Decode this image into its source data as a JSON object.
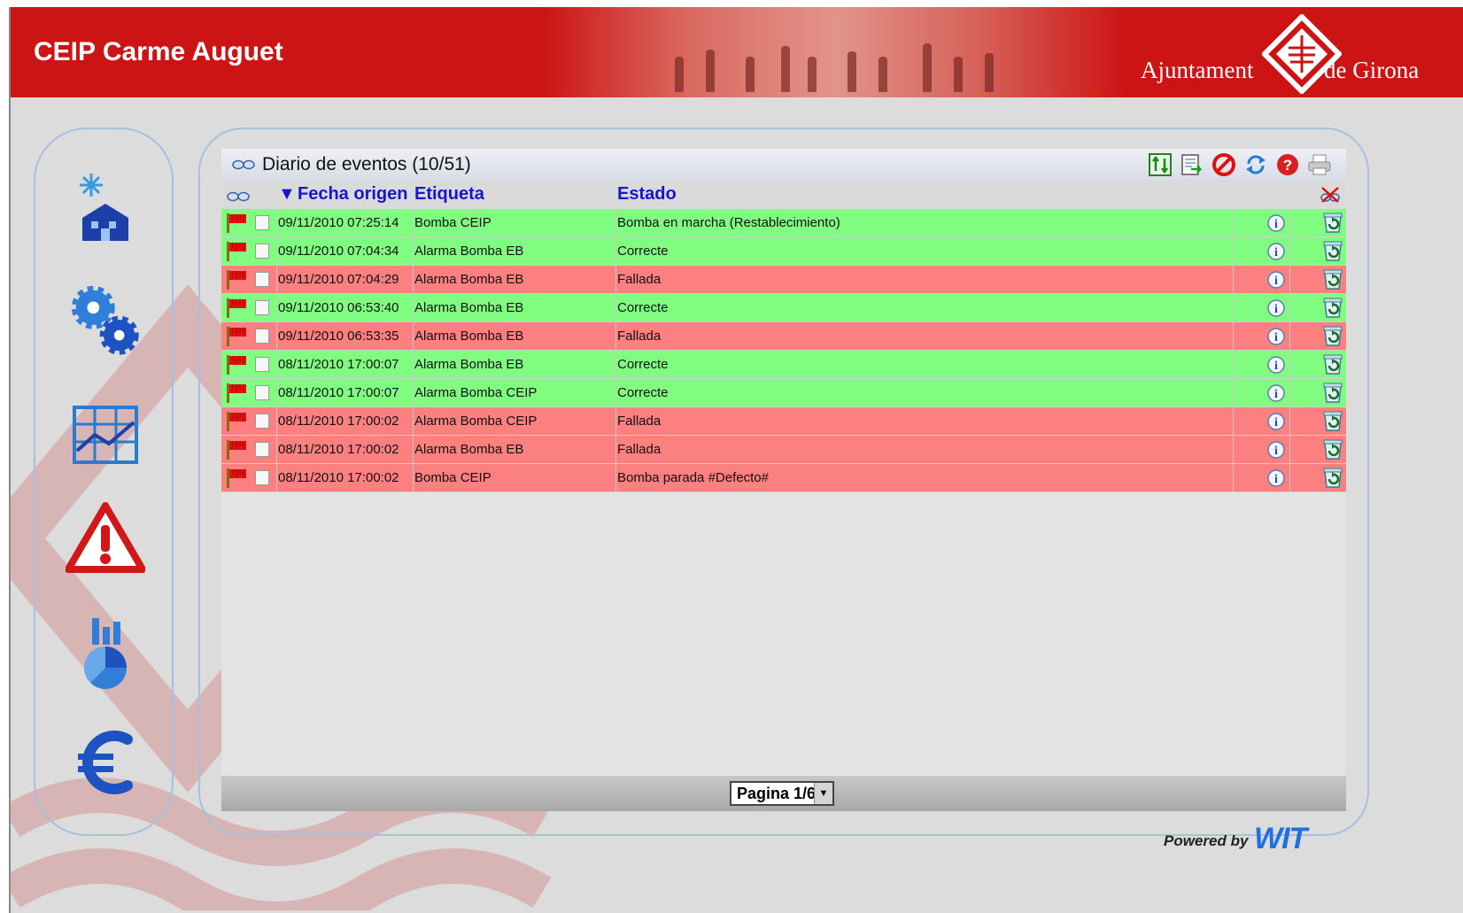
{
  "header": {
    "title": "CEIP Carme Auguet",
    "org_left": "Ajuntament",
    "org_right": "de Girona"
  },
  "nav": {
    "items": [
      {
        "name": "home-icon"
      },
      {
        "name": "gears-icon"
      },
      {
        "name": "chart-icon"
      },
      {
        "name": "warning-icon"
      },
      {
        "name": "statistics-icon"
      },
      {
        "name": "euro-icon"
      }
    ]
  },
  "events": {
    "title": "Diario de eventos (10/51)",
    "columns": {
      "date": "Fecha origen",
      "label": "Etiqueta",
      "state": "Estado"
    },
    "sort_indicator": "▼",
    "rows": [
      {
        "date": "09/11/2010 07:25:14",
        "label": "Bomba CEIP",
        "state": "Bomba en marcha (Restablecimiento)",
        "status": "ok"
      },
      {
        "date": "09/11/2010 07:04:34",
        "label": "Alarma Bomba EB",
        "state": "Correcte",
        "status": "ok"
      },
      {
        "date": "09/11/2010 07:04:29",
        "label": "Alarma Bomba EB",
        "state": "Fallada",
        "status": "bad"
      },
      {
        "date": "09/11/2010 06:53:40",
        "label": "Alarma Bomba EB",
        "state": "Correcte",
        "status": "ok"
      },
      {
        "date": "09/11/2010 06:53:35",
        "label": "Alarma Bomba EB",
        "state": "Fallada",
        "status": "bad"
      },
      {
        "date": "08/11/2010 17:00:07",
        "label": "Alarma Bomba EB",
        "state": "Correcte",
        "status": "ok"
      },
      {
        "date": "08/11/2010 17:00:07",
        "label": "Alarma Bomba CEIP",
        "state": "Correcte",
        "status": "ok"
      },
      {
        "date": "08/11/2010 17:00:02",
        "label": "Alarma Bomba CEIP",
        "state": "Fallada",
        "status": "bad"
      },
      {
        "date": "08/11/2010 17:00:02",
        "label": "Alarma Bomba EB",
        "state": "Fallada",
        "status": "bad"
      },
      {
        "date": "08/11/2010 17:00:02",
        "label": "Bomba CEIP",
        "state": "Bomba parada #Defecto#",
        "status": "bad"
      }
    ],
    "pager_value": "Pagina 1/6"
  },
  "footer": {
    "powered_by": "Powered by",
    "brand": "WIT"
  },
  "colors": {
    "ok": "#80fc80",
    "bad": "#fc8080",
    "header": "#cc1414",
    "link": "#1515cc"
  }
}
